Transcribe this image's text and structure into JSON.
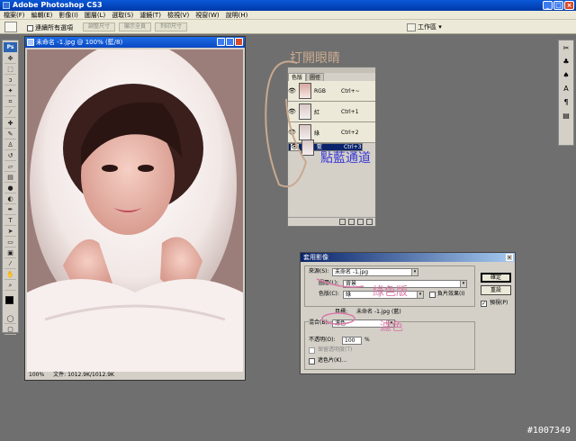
{
  "app": {
    "title": "Adobe Photoshop CS3",
    "win_minimize": "_",
    "win_maximize": "□",
    "win_close": "×"
  },
  "menu": [
    "檔案(F)",
    "編輯(E)",
    "影像(I)",
    "圖層(L)",
    "選取(S)",
    "濾鏡(T)",
    "檢視(V)",
    "視窗(W)",
    "說明(H)"
  ],
  "options": {
    "checkbox_label": "連續所有選項",
    "btn1": "調整尺寸",
    "btn2": "顯示全頁",
    "btn3": "列印尺寸",
    "workspace": "工作區 ▾"
  },
  "document": {
    "title": "未命名 -1.jpg @ 100% (藍/8)",
    "zoom": "100%",
    "status": "文件: 1012.9K/1012.9K"
  },
  "channels": {
    "tabs": [
      "色版",
      "圖徑"
    ],
    "rows": [
      {
        "name": "RGB",
        "key": "Ctrl+~",
        "selected": false
      },
      {
        "name": "紅",
        "key": "Ctrl+1",
        "selected": false
      },
      {
        "name": "綠",
        "key": "Ctrl+2",
        "selected": false
      },
      {
        "name": "藍",
        "key": "Ctrl+3",
        "selected": true
      }
    ]
  },
  "dialog": {
    "title": "套用影像",
    "source_label": "來源(S):",
    "source_value": "未命名 -1.jpg",
    "layer_label": "圖層(L):",
    "layer_value": "背景",
    "channel_label": "色版(C):",
    "channel_value": "綠",
    "invert_label": "負片效果(I)",
    "target_label": "目標:",
    "target_value": "未命名 -1.jpg (藍)",
    "blend_label": "混合(B):",
    "blend_value": "濾色",
    "opacity_label": "不透明(O):",
    "opacity_value": "100",
    "opacity_unit": "%",
    "preserve_label": "保留透明度(T)",
    "mask_label": "遮色片(K)...",
    "ok": "確定",
    "reset": "重設",
    "preview_label": "預視(P)"
  },
  "annotations": {
    "open_eye": "打開眼睛",
    "click_blue": "點藍通道",
    "green_channel": "綠色版",
    "screen": "濾色",
    "color_brown": "#c9a98f",
    "color_blue": "#3a3ad6",
    "color_pink": "#d97aa8"
  },
  "watermark": "#1007349"
}
